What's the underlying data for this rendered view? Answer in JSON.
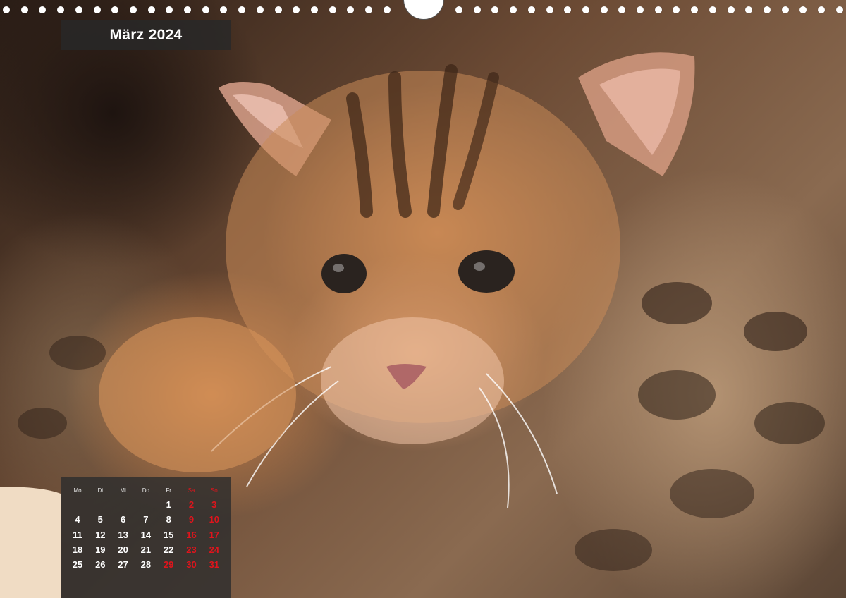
{
  "calendar": {
    "title": "März 2024",
    "weekdays": [
      "Mo",
      "Di",
      "Mi",
      "Do",
      "Fr",
      "Sa",
      "So"
    ],
    "weekend_color": "#e0141c",
    "weeks": [
      [
        "",
        "",
        "",
        "",
        "1",
        "2",
        "3"
      ],
      [
        "4",
        "5",
        "6",
        "7",
        "8",
        "9",
        "10"
      ],
      [
        "11",
        "12",
        "13",
        "14",
        "15",
        "16",
        "17"
      ],
      [
        "18",
        "19",
        "20",
        "21",
        "22",
        "23",
        "24"
      ],
      [
        "25",
        "26",
        "27",
        "28",
        "29",
        "30",
        "31"
      ]
    ],
    "holiday_days": [
      "29"
    ]
  },
  "photo": {
    "subject": "kitten-photo"
  }
}
